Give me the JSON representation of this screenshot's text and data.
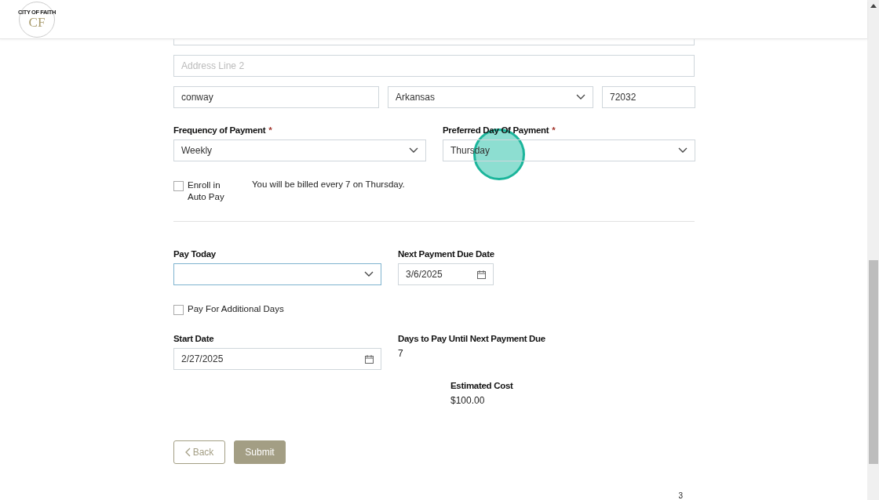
{
  "header": {
    "logo": {
      "name": "CITY OF FAITH",
      "initials": "CF"
    }
  },
  "address": {
    "line_1": {
      "cut_off": true
    },
    "line_2": {
      "placeholder": "Address Line 2"
    },
    "city": {
      "value": "conway"
    },
    "state": {
      "value": "Arkansas"
    },
    "zip": {
      "value": "72032"
    }
  },
  "frequency": {
    "label": "Frequency of Payment",
    "required_mark": "*",
    "value": "Weekly"
  },
  "preferred_day": {
    "label": "Preferred Day Of Payment",
    "required_mark": "*",
    "value": "Thursday",
    "click_marker": true
  },
  "auto_pay": {
    "label": "Enroll in Auto Pay",
    "checked": false
  },
  "billing_note": "You will be billed every 7 on Thursday.",
  "pay_today": {
    "label": "Pay Today",
    "focused": true
  },
  "next_due": {
    "label": "Next Payment Due Date",
    "value": "3/6/2025"
  },
  "additional_days": {
    "label": "Pay For Additional Days",
    "checked": false
  },
  "start_date": {
    "label": "Start Date",
    "value": "2/27/2025"
  },
  "days_to_pay": {
    "label": "Days to Pay Until Next Payment Due",
    "value": "7"
  },
  "estimated_cost": {
    "label": "Estimated Cost",
    "value": "$100.00"
  },
  "buttons": [
    {
      "label": "Back",
      "kind": "back"
    },
    {
      "label": "Submit",
      "kind": "submit"
    }
  ],
  "page_number": "3"
}
